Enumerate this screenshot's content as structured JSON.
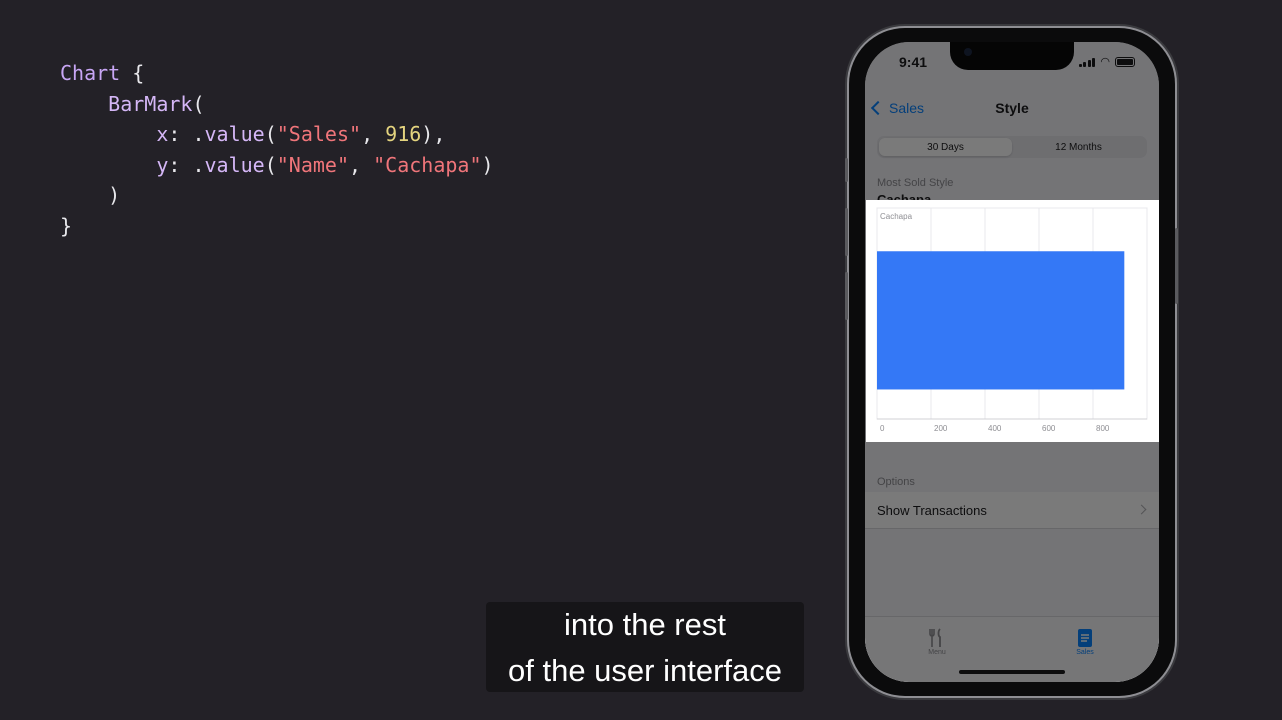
{
  "code": {
    "lines": [
      [
        {
          "t": "Chart",
          "c": "kw"
        },
        {
          "t": " {",
          "c": "plain"
        }
      ],
      [
        {
          "t": "    ",
          "c": "plain"
        },
        {
          "t": "BarMark",
          "c": "fn"
        },
        {
          "t": "(",
          "c": "plain"
        }
      ],
      [
        {
          "t": "        ",
          "c": "plain"
        },
        {
          "t": "x",
          "c": "fn"
        },
        {
          "t": ": .",
          "c": "plain"
        },
        {
          "t": "value",
          "c": "fn"
        },
        {
          "t": "(",
          "c": "plain"
        },
        {
          "t": "\"Sales\"",
          "c": "str"
        },
        {
          "t": ", ",
          "c": "plain"
        },
        {
          "t": "916",
          "c": "num"
        },
        {
          "t": "),",
          "c": "plain"
        }
      ],
      [
        {
          "t": "        ",
          "c": "plain"
        },
        {
          "t": "y",
          "c": "fn"
        },
        {
          "t": ": .",
          "c": "plain"
        },
        {
          "t": "value",
          "c": "fn"
        },
        {
          "t": "(",
          "c": "plain"
        },
        {
          "t": "\"Name\"",
          "c": "str"
        },
        {
          "t": ", ",
          "c": "plain"
        },
        {
          "t": "\"Cachapa\"",
          "c": "str"
        },
        {
          "t": ")",
          "c": "plain"
        }
      ],
      [
        {
          "t": "    )",
          "c": "plain"
        }
      ],
      [
        {
          "t": "}",
          "c": "plain"
        }
      ]
    ]
  },
  "caption": {
    "line1": "into the rest",
    "line2": "of the user interface"
  },
  "phone": {
    "status_time": "9:41",
    "nav": {
      "back_label": "Sales",
      "title": "Style"
    },
    "segments": [
      "30 Days",
      "12 Months"
    ],
    "segment_selected": 0,
    "most_sold_label": "Most Sold Style",
    "most_sold_value": "Cachapa",
    "options_label": "Options",
    "show_transactions_label": "Show Transactions",
    "tabs": [
      {
        "label": "Menu",
        "icon": "fork-knife-icon"
      },
      {
        "label": "Sales",
        "icon": "document-icon"
      }
    ],
    "active_tab": 1,
    "accent_color": "#0a84ff"
  },
  "chart_data": {
    "type": "bar",
    "orientation": "horizontal",
    "categories": [
      "Cachapa"
    ],
    "values": [
      916
    ],
    "xlim": [
      0,
      1000
    ],
    "xticks": [
      0,
      200,
      400,
      600,
      800
    ],
    "grid": true,
    "bar_color": "#3478f6"
  }
}
